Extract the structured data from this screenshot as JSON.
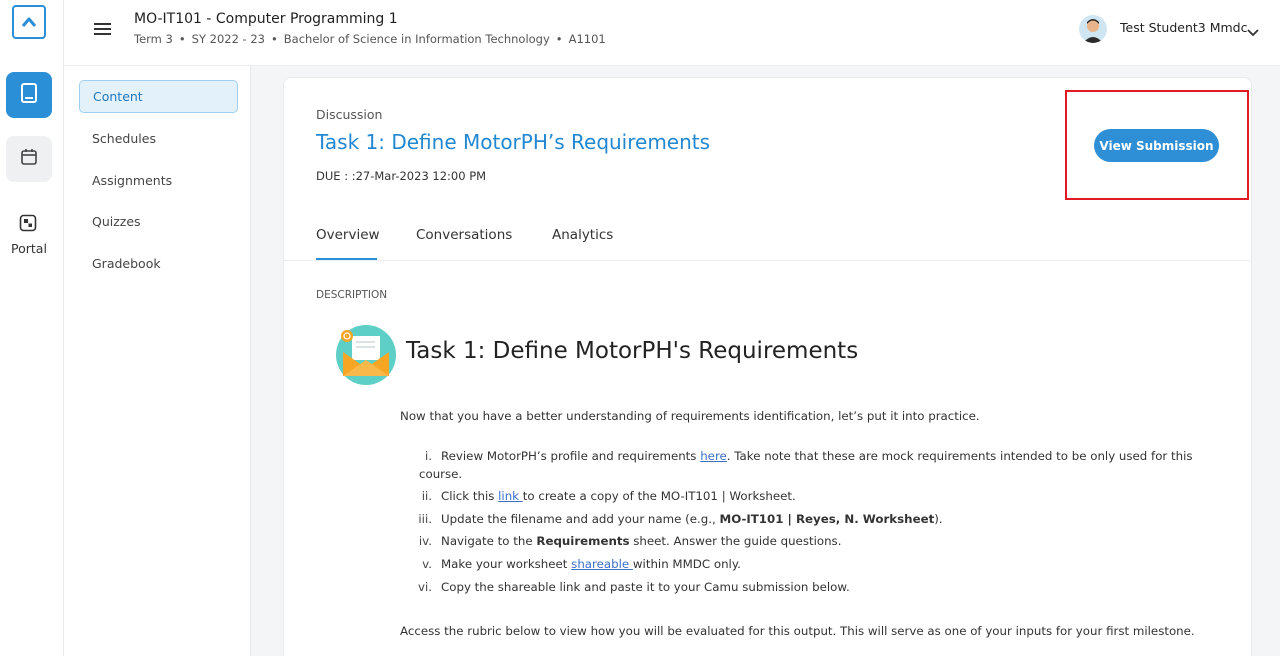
{
  "rail": {
    "portal_label": "Portal"
  },
  "header": {
    "course_title": "MO-IT101 - Computer Programming 1",
    "term": "Term 3",
    "school_year": "SY 2022 - 23",
    "program": "Bachelor of Science in Information Technology",
    "section": "A1101",
    "user_name": "Test Student3 Mmdc"
  },
  "subnav": {
    "items": [
      {
        "label": "Content"
      },
      {
        "label": "Schedules"
      },
      {
        "label": "Assignments"
      },
      {
        "label": "Quizzes"
      },
      {
        "label": "Gradebook"
      }
    ]
  },
  "task": {
    "kind": "Discussion",
    "title": "Task 1: Define MotorPH’s Requirements",
    "due": "DUE : :27-Mar-2023 12:00 PM",
    "view_button": "View Submission"
  },
  "tabs": [
    {
      "label": "Overview"
    },
    {
      "label": "Conversations"
    },
    {
      "label": "Analytics"
    }
  ],
  "description": {
    "label": "DESCRIPTION",
    "heading": "Task 1: Define MotorPH's Requirements",
    "intro": "Now that you have a better understanding of requirements identification, let’s put it into practice.",
    "steps": [
      {
        "num": "i.",
        "before": "Review MotorPH’s profile and requirements ",
        "link": "here",
        "after": ". Take note that these are mock requirements intended to be only used for this",
        "line2": "course."
      },
      {
        "num": "ii.",
        "before": "Click this ",
        "link": "link ",
        "after": "to create a copy of the MO-IT101 | Worksheet."
      },
      {
        "num": "iii.",
        "before": "Update the filename and add your name (e.g., ",
        "bold": "MO-IT101 | Reyes, N. Worksheet",
        "after": ")."
      },
      {
        "num": "iv.",
        "before": "Navigate to the ",
        "bold": "Requirements",
        "after": " sheet. Answer the guide questions."
      },
      {
        "num": "v.",
        "before": "Make your worksheet ",
        "link": "shareable ",
        "after": "within MMDC only."
      },
      {
        "num": "vi.",
        "before": "Copy the shareable link and paste it to your Camu submission below."
      }
    ],
    "outro": "Access the rubric below to view how you will be evaluated for this output. This will serve as one of your inputs for your first milestone."
  }
}
